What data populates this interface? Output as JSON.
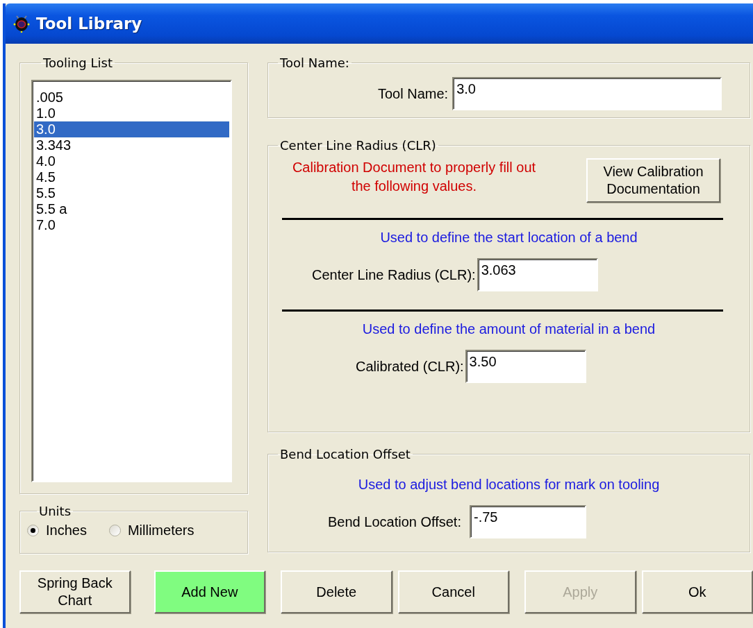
{
  "window": {
    "title": "Tool Library"
  },
  "tooling_list": {
    "label": "Tooling List",
    "items": [
      {
        "label": ".005",
        "selected": false
      },
      {
        "label": "1.0",
        "selected": false
      },
      {
        "label": "3.0",
        "selected": true
      },
      {
        "label": "3.343",
        "selected": false
      },
      {
        "label": "4.0",
        "selected": false
      },
      {
        "label": "4.5",
        "selected": false
      },
      {
        "label": "5.5",
        "selected": false
      },
      {
        "label": "5.5 a",
        "selected": false
      },
      {
        "label": "7.0",
        "selected": false
      }
    ]
  },
  "units": {
    "label": "Units",
    "options": [
      {
        "label": "Inches",
        "selected": true
      },
      {
        "label": "Millimeters",
        "selected": false
      }
    ]
  },
  "tool_name_group": {
    "label": "Tool Name:",
    "field_label": "Tool Name:",
    "value": "3.0"
  },
  "clr_group": {
    "label": "Center Line Radius (CLR)",
    "note": "Calibration Document to properly fill out the following values.",
    "button": "View Calibration Documentation",
    "sections": [
      {
        "hint": "Used to define the start location of a bend",
        "field_label": "Center Line Radius (CLR):",
        "value": "3.063"
      },
      {
        "hint": "Used to define the amount of material in a bend",
        "field_label": "Calibrated (CLR):",
        "value": "3.50"
      }
    ]
  },
  "offset_group": {
    "label": "Bend Location Offset",
    "hint": "Used to adjust bend locations for mark on tooling",
    "field_label": "Bend Location Offset:",
    "value": "-.75"
  },
  "buttons": [
    {
      "label": "Spring Back Chart",
      "kind": "plain",
      "disabled": false
    },
    {
      "label": "Add New",
      "kind": "highlight",
      "disabled": false
    },
    {
      "label": "Delete",
      "kind": "plain",
      "disabled": false
    },
    {
      "label": "Cancel",
      "kind": "plain",
      "disabled": false
    },
    {
      "label": "Apply",
      "kind": "plain",
      "disabled": true
    },
    {
      "label": "Ok",
      "kind": "plain",
      "disabled": false
    }
  ]
}
